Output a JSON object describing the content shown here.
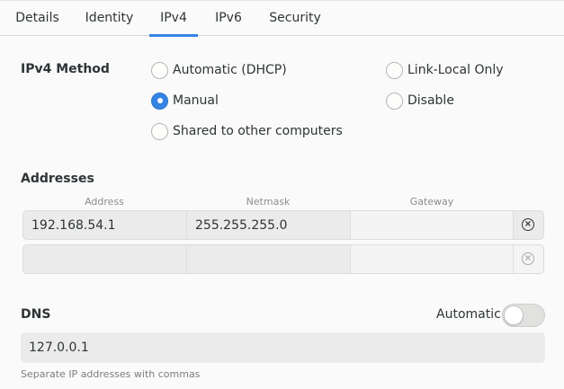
{
  "tabs": [
    {
      "label": "Details"
    },
    {
      "label": "Identity"
    },
    {
      "label": "IPv4"
    },
    {
      "label": "IPv6"
    },
    {
      "label": "Security"
    }
  ],
  "active_tab": "IPv4",
  "ipv4_method": {
    "label": "IPv4 Method",
    "options": {
      "automatic_dhcp": "Automatic (DHCP)",
      "link_local_only": "Link-Local Only",
      "manual": "Manual",
      "disable": "Disable",
      "shared": "Shared to other computers"
    },
    "selected": "Manual"
  },
  "addresses": {
    "label": "Addresses",
    "columns": [
      "Address",
      "Netmask",
      "Gateway"
    ],
    "rows": [
      {
        "address": "192.168.54.1",
        "netmask": "255.255.255.0",
        "gateway": ""
      },
      {
        "address": "",
        "netmask": "",
        "gateway": ""
      }
    ]
  },
  "dns": {
    "label": "DNS",
    "automatic_label": "Automatic",
    "automatic": false,
    "value": "127.0.0.1",
    "hint": "Separate IP addresses with commas"
  },
  "icons": {
    "remove": "close-circle-icon"
  },
  "colors": {
    "accent": "#3584e4"
  }
}
